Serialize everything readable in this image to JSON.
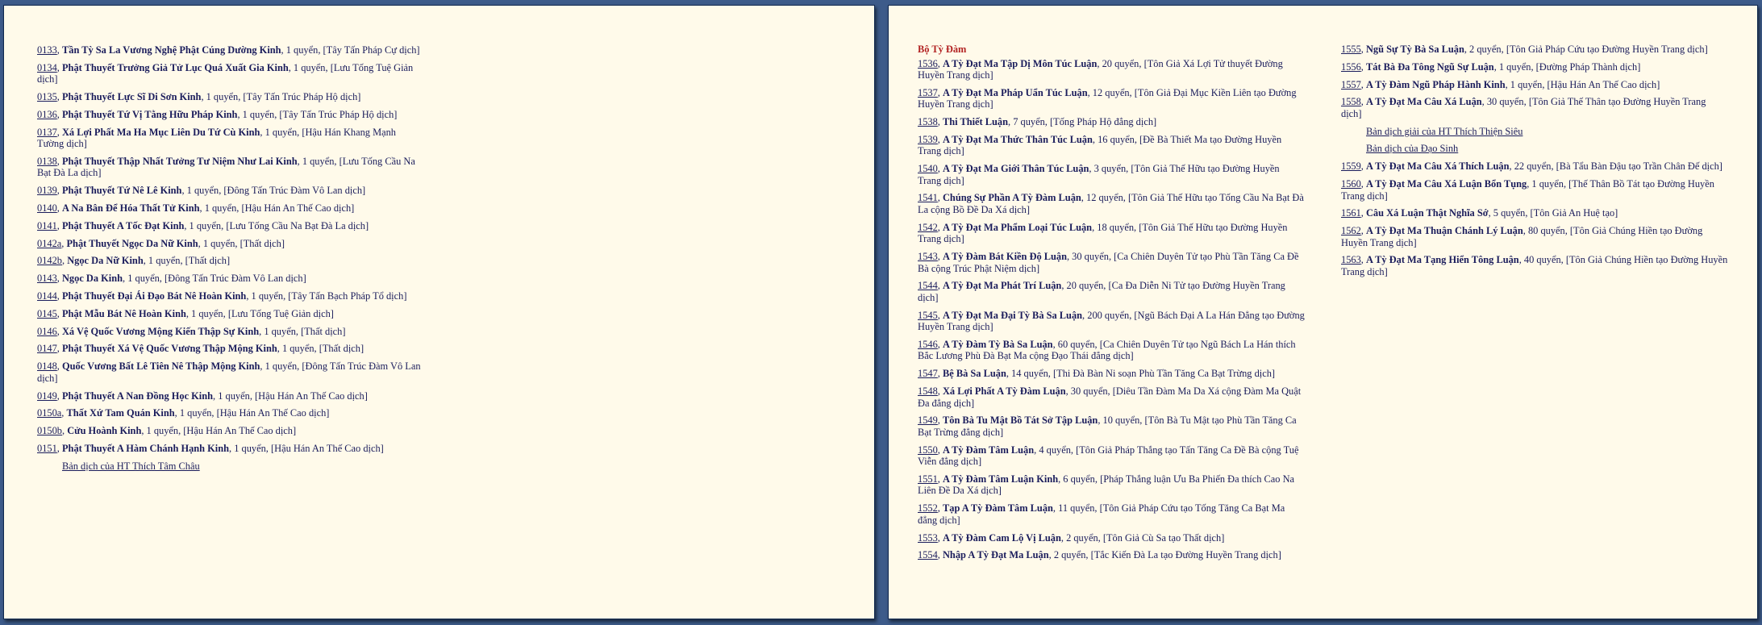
{
  "left_page": {
    "entries": [
      {
        "num": "0133",
        "title": "Tần Tỳ Sa La Vương Nghệ Phật Cúng Dường Kinh",
        "rest": ", 1 quyển, [Tây Tấn Pháp Cự dịch]"
      },
      {
        "num": "0134",
        "title": "Phật Thuyết Trưởng Giả Tử Lục Quá Xuất Gia Kinh",
        "rest": ", 1 quyển, [Lưu Tống Tuệ Giản dịch]"
      },
      {
        "num": "0135",
        "title": "Phật Thuyết Lực Sĩ Di Sơn Kinh",
        "rest": ", 1 quyển, [Tây Tấn Trúc Pháp Hộ dịch]"
      },
      {
        "num": "0136",
        "title": "Phật Thuyết Tứ Vị Tằng Hữu Pháp Kinh",
        "rest": ", 1 quyển, [Tây Tấn Trúc Pháp Hộ dịch]"
      },
      {
        "num": "0137",
        "title": "Xá Lợi Phất Ma Ha Mục Liên Du Tứ Cù Kinh",
        "rest": ", 1 quyển, [Hậu Hán Khang Mạnh Tường dịch]"
      },
      {
        "num": "0138",
        "title": "Phật Thuyết Thập Nhất Tưởng Tư Niệm Như Lai Kinh",
        "rest": ", 1 quyển, [Lưu Tống Cầu Na Bạt Đà La dịch]"
      },
      {
        "num": "0139",
        "title": "Phật Thuyết Tứ Nê Lê Kinh",
        "rest": ", 1 quyển, [Đông Tấn Trúc Đàm Vô Lan dịch]"
      },
      {
        "num": "0140",
        "title": "A Na Bân Để Hóa Thất Tử Kinh",
        "rest": ", 1 quyển, [Hậu Hán An Thế Cao dịch]"
      },
      {
        "num": "0141",
        "title": "Phật Thuyết A Tốc Đạt Kinh",
        "rest": ", 1 quyển, [Lưu Tống Cầu Na Bạt Đà La dịch]"
      },
      {
        "num": "0142a",
        "title": "Phật Thuyết Ngọc Da Nữ Kinh",
        "rest": ", 1 quyển, [Thất dịch]"
      },
      {
        "num": "0142b",
        "title": "Ngọc Da Nữ Kinh",
        "rest": ", 1 quyển, [Thất dịch]"
      },
      {
        "num": "0143",
        "title": "Ngọc Da Kinh",
        "rest": ", 1 quyển, [Đông Tấn Trúc Đàm Vô Lan dịch]"
      },
      {
        "num": "0144",
        "title": "Phật Thuyết Đại Ái Đạo Bát Nê Hoàn Kinh",
        "rest": ", 1 quyển, [Tây Tấn Bạch Pháp Tổ dịch]"
      },
      {
        "num": "0145",
        "title": "Phật Mẫu Bát Nê Hoàn Kinh",
        "rest": ", 1 quyển, [Lưu Tống Tuệ Giản dịch]"
      },
      {
        "num": "0146",
        "title": "Xá Vệ Quốc Vương Mộng Kiến Thập Sự Kinh",
        "rest": ", 1 quyển, [Thất dịch]"
      },
      {
        "num": "0147",
        "title": "Phật Thuyết Xá Vệ Quốc Vương Thập Mộng Kinh",
        "rest": ", 1 quyển, [Thất dịch]"
      },
      {
        "num": "0148",
        "title": "Quốc Vương Bất Lê Tiên Nê Thập Mộng Kinh",
        "rest": ", 1 quyển, [Đông Tấn Trúc Đàm Vô Lan dịch]"
      },
      {
        "num": "0149",
        "title": "Phật Thuyết A Nan Đồng Học Kinh",
        "rest": ", 1 quyển, [Hậu Hán An Thế Cao dịch]"
      },
      {
        "num": "0150a",
        "title": "Thất Xứ Tam Quán Kinh",
        "rest": ", 1 quyển, [Hậu Hán An Thế Cao dịch]"
      },
      {
        "num": "0150b",
        "title": "Cửu Hoành Kinh",
        "rest": ", 1 quyển, [Hậu Hán An Thế Cao dịch]"
      },
      {
        "num": "0151",
        "title": "Phật Thuyết A Hàm Chánh Hạnh Kinh",
        "rest": ", 1 quyển, [Hậu Hán An Thế Cao dịch]"
      }
    ],
    "link": "Bản dịch của HT Thích Tâm Châu"
  },
  "right_page": {
    "heading": "Bộ Tỳ Đàm",
    "col_a": [
      {
        "num": "1536",
        "title": "A Tỳ Đạt Ma Tập Dị Môn Túc Luận",
        "rest": ", 20 quyển, [Tôn Giả Xá Lợi Tử thuyết Đường Huyền Trang dịch]"
      },
      {
        "num": "1537",
        "title": "A Tỳ Đạt Ma Pháp Uẩn Túc Luận",
        "rest": ", 12 quyển, [Tôn Giả Đại Mục Kiền Liên tạo Đường Huyền Trang dịch]"
      },
      {
        "num": "1538",
        "title": "Thi Thiết Luận",
        "rest": ", 7 quyển, [Tống Pháp Hộ đẳng dịch]"
      },
      {
        "num": "1539",
        "title": "A Tỳ Đạt Ma Thức Thân Túc Luận",
        "rest": ", 16 quyển, [Đề Bà Thiết Ma tạo Đường Huyền Trang dịch]"
      },
      {
        "num": "1540",
        "title": "A Tỳ Đạt Ma Giới Thân Túc Luận",
        "rest": ", 3 quyển, [Tôn Giả Thế Hữu tạo Đường Huyền Trang dịch]"
      },
      {
        "num": "1541",
        "title": "Chúng Sự Phần A Tỳ Đàm Luận",
        "rest": ", 12 quyển, [Tôn Giả Thế Hữu tạo Tống Cầu Na Bạt Đà La cộng Bồ Đề Da Xá dịch]"
      },
      {
        "num": "1542",
        "title": "A Tỳ Đạt Ma Phẩm Loại Túc Luận",
        "rest": ", 18 quyển, [Tôn Giả Thế Hữu tạo Đường Huyền Trang dịch]"
      },
      {
        "num": "1543",
        "title": "A Tỳ Đàm Bát Kiền Độ Luận",
        "rest": ", 30 quyển, [Ca Chiên Duyên Tử tạo Phù Tần Tăng Ca Đề Bà cộng Trúc Phật Niệm dịch]"
      },
      {
        "num": "1544",
        "title": "A Tỳ Đạt Ma Phát Trí Luận",
        "rest": ", 20 quyển, [Ca Đa Diễn Ni Tử tạo Đường Huyền Trang dịch]"
      },
      {
        "num": "1545",
        "title": "A Tỳ Đạt Ma Đại Tỳ Bà Sa Luận",
        "rest": ", 200 quyển, [Ngũ Bách Đại A La Hán Đẳng tạo Đường Huyền Trang dịch]"
      },
      {
        "num": "1546",
        "title": "A Tỳ Đàm Tỳ Bà Sa Luận",
        "rest": ", 60 quyển, [Ca Chiên Duyên Tử tạo Ngũ Bách La Hán thích Bắc Lương Phù Đà Bạt Ma cộng Đạo Thái đẳng dịch]"
      },
      {
        "num": "1547",
        "title": "Bệ Bà Sa Luận",
        "rest": ", 14 quyển, [Thi Đà Bàn Ni soạn Phù Tần Tăng Ca Bạt Trừng dịch]"
      },
      {
        "num": "1548",
        "title": "Xá Lợi Phất A Tỳ Đàm Luận",
        "rest": ", 30 quyển, [Diêu Tần Đàm Ma Da Xá cộng Đàm Ma Quật Đa đẳng dịch]"
      },
      {
        "num": "1549",
        "title": "Tôn Bà Tu Mật Bồ Tát Sở Tập Luận",
        "rest": ", 10 quyển, [Tôn Bà Tu Mật tạo Phù Tần Tăng Ca Bạt Trừng đẳng dịch]"
      },
      {
        "num": "1550",
        "title": "A Tỳ Đàm Tâm Luận",
        "rest": ", 4 quyển, [Tôn Giả Pháp Thắng tạo Tấn Tăng Ca Đề Bà cộng Tuệ Viễn đẳng dịch]"
      },
      {
        "num": "1551",
        "title": "A Tỳ Đàm Tâm Luận Kinh",
        "rest": ", 6 quyển, [Pháp Thắng luận Ưu Ba Phiến Đa thích Cao Na Liên Đề Da Xá dịch]"
      },
      {
        "num": "1552",
        "title": "Tạp A Tỳ Đàm Tâm Luận",
        "rest": ", 11 quyển, [Tôn Giả Pháp Cứu tạo Tống Tăng Ca Bạt Ma đẳng dịch]"
      },
      {
        "num": "1553",
        "title": "A Tỳ Đàm Cam Lộ Vị Luận",
        "rest": ", 2 quyển, [Tôn Giả Cù Sa tạo Thất dịch]"
      },
      {
        "num": "1554",
        "title": "Nhập A Tỳ Đạt Ma Luận",
        "rest": ", 2 quyển, [Tắc Kiến Đà La tạo Đường Huyền Trang dịch]"
      }
    ],
    "col_b_first": [
      {
        "num": "1555",
        "title": "Ngũ Sự Tỳ Bà Sa Luận",
        "rest": ", 2 quyển, [Tôn Giả Pháp Cứu tạo Đường Huyền Trang dịch]"
      },
      {
        "num": "1556",
        "title": "Tát Bà Đa Tông Ngũ Sự Luận",
        "rest": ", 1 quyển, [Đường Pháp Thành dịch]"
      },
      {
        "num": "1557",
        "title": "A Tỳ Đàm Ngũ Pháp Hành Kinh",
        "rest": ", 1 quyển, [Hậu Hán An Thế Cao dịch]"
      },
      {
        "num": "1558",
        "title": "A Tỳ Đạt Ma Câu Xá Luận",
        "rest": ", 30 quyển, [Tôn Giả Thế Thân tạo Đường Huyền Trang dịch]"
      }
    ],
    "links": [
      "Bản dịch giải của HT Thích Thiện Siêu",
      "Bản dịch của Đạo Sinh"
    ],
    "col_b_second": [
      {
        "num": "1559",
        "title": "A Tỳ Đạt Ma Câu Xá Thích Luận",
        "rest": ", 22 quyển, [Bà Tẩu Bàn Đậu tạo Trần Chân Đế dịch]"
      },
      {
        "num": "1560",
        "title": "A Tỳ Đạt Ma Câu Xá Luận Bổn Tụng",
        "rest": ", 1 quyển, [Thế Thân Bồ Tát tạo Đường Huyền Trang dịch]"
      },
      {
        "num": "1561",
        "title": "Câu Xá Luận Thật Nghĩa Sớ",
        "rest": ", 5 quyển, [Tôn Giả An Huệ tạo]"
      },
      {
        "num": "1562",
        "title": "A Tỳ Đạt Ma Thuận Chánh Lý Luận",
        "rest": ", 80 quyển, [Tôn Giả Chúng Hiền tạo Đường Huyền Trang dịch]"
      },
      {
        "num": "1563",
        "title": "A Tỳ Đạt Ma Tạng Hiển Tông Luận",
        "rest": ", 40 quyển, [Tôn Giả Chúng Hiền tạo Đường Huyền Trang dịch]"
      }
    ]
  }
}
